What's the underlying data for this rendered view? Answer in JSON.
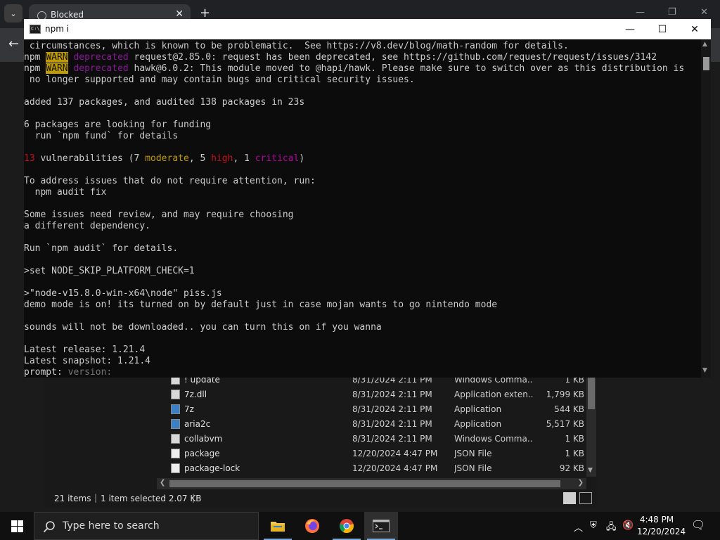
{
  "browser": {
    "tab_title": "Blocked",
    "tab_close": "✕",
    "new_tab": "+",
    "tab_list": "⌄",
    "back": "←"
  },
  "console": {
    "title": "npm i",
    "icon_text": "C:\\_",
    "minimize": "—",
    "maximize": "☐",
    "close": "✕",
    "lines": {
      "l1": " circumstances, which is known to be problematic.  See https://v8.dev/blog/math-random for details.",
      "l2_pre": "npm ",
      "l2_warn": "WARN",
      "l2_dep": " deprecated",
      "l2_post": " request@2.85.0: request has been deprecated, see https://github.com/request/request/issues/3142",
      "l3_pre": "npm ",
      "l3_warn": "WARN",
      "l3_dep": " deprecated",
      "l3_post": " hawk@6.0.2: This module moved to @hapi/hawk. Please make sure to switch over as this distribution is",
      "l4": " no longer supported and may contain bugs and critical security issues.",
      "l5": "",
      "l6": "added 137 packages, and audited 138 packages in 23s",
      "l7": "",
      "l8": "6 packages are looking for funding",
      "l9": "  run `npm fund` for details",
      "l10": "",
      "l11_count": "13",
      "l11_a": " vulnerabilities (7 ",
      "l11_moderate": "moderate",
      "l11_b": ", 5 ",
      "l11_high": "high",
      "l11_c": ", 1 ",
      "l11_critical": "critical",
      "l11_d": ")",
      "l12": "",
      "l13": "To address issues that do not require attention, run:",
      "l14": "  npm audit fix",
      "l15": "",
      "l16": "Some issues need review, and may require choosing",
      "l17": "a different dependency.",
      "l18": "",
      "l19": "Run `npm audit` for details.",
      "l20": "",
      "l21": ">set NODE_SKIP_PLATFORM_CHECK=1",
      "l22": "",
      "l23": ">\"node-v15.8.0-win-x64\\node\" piss.js",
      "l24": "demo mode is on! its turned on by default just in case mojan wants to go nintendo mode",
      "l25": "",
      "l26": "sounds will not be downloaded.. you can turn this on if you wanna",
      "l27": "",
      "l28": "Latest release: 1.21.4",
      "l29": "Latest snapshot: 1.21.4",
      "l30_prompt": "prompt:",
      "l30_hint": " version:"
    }
  },
  "explorer": {
    "files": [
      {
        "name": "! update",
        "date": "8/31/2024 2:11 PM",
        "type": "Windows Comma...",
        "size": "1 KB"
      },
      {
        "name": "7z.dll",
        "date": "8/31/2024 2:11 PM",
        "type": "Application exten...",
        "size": "1,799 KB"
      },
      {
        "name": "7z",
        "date": "8/31/2024 2:11 PM",
        "type": "Application",
        "size": "544 KB"
      },
      {
        "name": "aria2c",
        "date": "8/31/2024 2:11 PM",
        "type": "Application",
        "size": "5,517 KB"
      },
      {
        "name": "collabvm",
        "date": "8/31/2024 2:11 PM",
        "type": "Windows Comma...",
        "size": "1 KB"
      },
      {
        "name": "package",
        "date": "12/20/2024 4:47 PM",
        "type": "JSON File",
        "size": "1 KB"
      },
      {
        "name": "package-lock",
        "date": "12/20/2024 4:47 PM",
        "type": "JSON File",
        "size": "92 KB"
      }
    ],
    "status_items": "21 items",
    "status_sep": "|",
    "status_selected": "1 item selected  2.07 KB"
  },
  "taskbar": {
    "search_placeholder": "Type here to search",
    "clock_time": "4:48 PM",
    "clock_date": "12/20/2024",
    "apps": [
      "file-explorer",
      "firefox",
      "chrome",
      "command-prompt"
    ]
  }
}
